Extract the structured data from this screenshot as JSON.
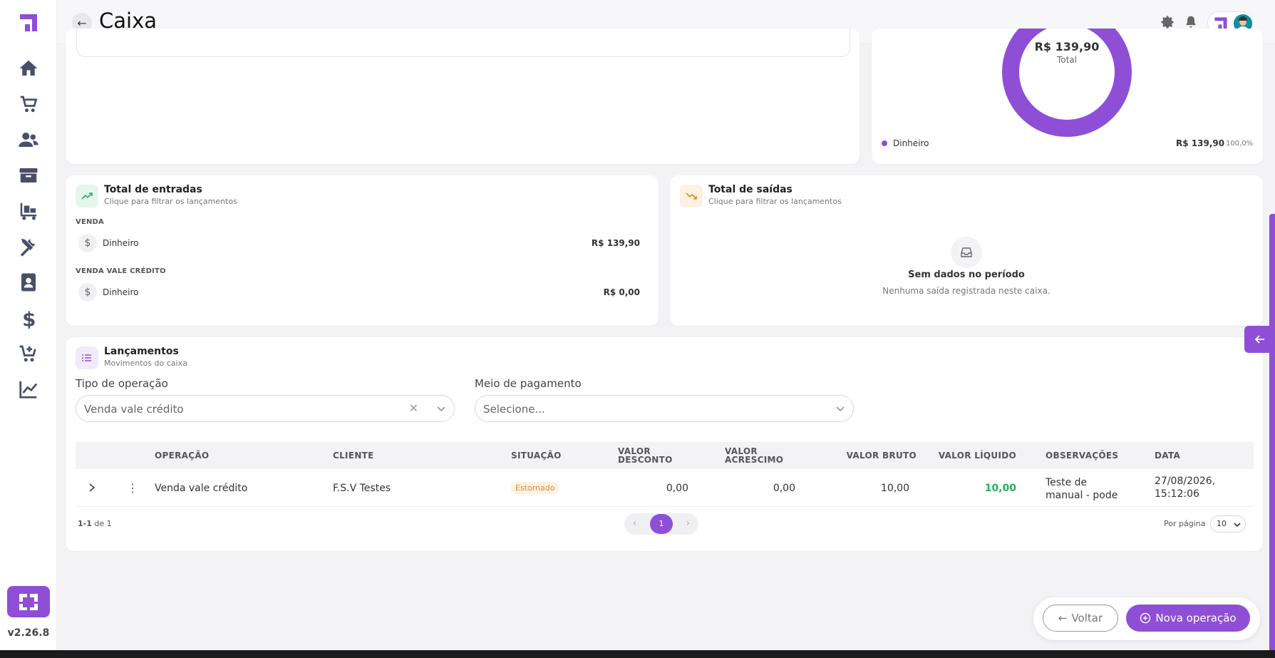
{
  "app": {
    "version": "v2.26.8",
    "accent": "#8e4fd6"
  },
  "header": {
    "title": "Caixa"
  },
  "sidebar": {
    "items": [
      {
        "icon": "home-icon"
      },
      {
        "icon": "cart-icon"
      },
      {
        "icon": "users-icon"
      },
      {
        "icon": "box-icon"
      },
      {
        "icon": "truck-icon"
      },
      {
        "icon": "tools-icon"
      },
      {
        "icon": "contact-icon"
      },
      {
        "icon": "dollar-icon"
      },
      {
        "icon": "cart-plus-icon"
      },
      {
        "icon": "chart-line-icon"
      }
    ]
  },
  "summary": {
    "total_value": "R$ 139,90",
    "total_label": "Total",
    "legend": [
      {
        "name": "Dinheiro",
        "value": "R$ 139,90",
        "pct": "100,0%"
      }
    ]
  },
  "entradas": {
    "title": "Total de entradas",
    "subtitle": "Clique para filtrar os lançamentos",
    "groups": [
      {
        "label": "VENDA",
        "method": "Dinheiro",
        "value": "R$ 139,90"
      },
      {
        "label": "VENDA VALE CRÉDITO",
        "method": "Dinheiro",
        "value": "R$ 0,00"
      }
    ]
  },
  "saidas": {
    "title": "Total de saídas",
    "subtitle": "Clique para filtrar os lançamentos",
    "empty_title": "Sem dados no período",
    "empty_sub": "Nenhuma saída registrada neste caixa."
  },
  "lancamentos": {
    "title": "Lançamentos",
    "subtitle": "Movimentos do caixa",
    "filter_tipo_label": "Tipo de operação",
    "filter_tipo_value": "Venda vale crédito",
    "filter_meio_label": "Meio de pagamento",
    "filter_meio_placeholder": "Selecione...",
    "columns": {
      "operacao": "OPERAÇÃO",
      "cliente": "CLIENTE",
      "situacao": "SITUAÇÃO",
      "desconto_1": "VALOR",
      "desconto_2": "DESCONTO",
      "acrescimo_1": "VALOR",
      "acrescimo_2": "ACRESCIMO",
      "bruto": "VALOR BRUTO",
      "liquido": "VALOR LÍQUIDO",
      "observacoes": "OBSERVAÇÕES",
      "data": "DATA"
    },
    "row": {
      "operacao": "Venda vale crédito",
      "cliente": "F.S.V Testes",
      "situacao": "Estornado",
      "desconto": "0,00",
      "acrescimo": "0,00",
      "bruto": "10,00",
      "liquido": "10,00",
      "obs_1": "Teste de",
      "obs_2": "manual - pode",
      "data_1": "27/08/2026,",
      "data_2": "15:12:06"
    },
    "pager_range": "1-1",
    "pager_of": "de 1",
    "current_page": "1",
    "per_page_label": "Por página",
    "per_page_value": "10"
  },
  "actions": {
    "back": "Voltar",
    "new": "Nova operação"
  }
}
